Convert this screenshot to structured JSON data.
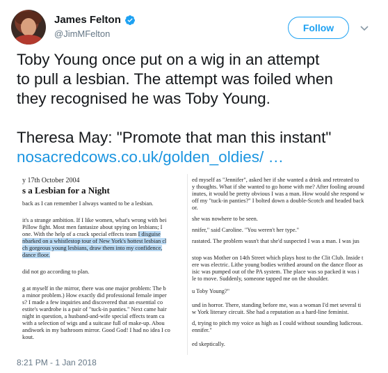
{
  "author": {
    "name": "James Felton",
    "handle": "@JimMFelton",
    "avatar_icon": "profile-photo",
    "verified_icon": "verified-badge-icon"
  },
  "actions": {
    "follow_label": "Follow",
    "more_icon": "chevron-down-icon"
  },
  "tweet": {
    "lines": [
      "Toby Young once put on a wig in an attempt",
      "to pull a lesbian. The attempt was foiled when",
      "they recognised he was Toby Young.",
      "Theresa May: \"Promote that man this instant\""
    ],
    "link": "nosacredcows.co.uk/golden_oldies/ …",
    "link_color": "#1b95e0"
  },
  "article": {
    "date": "y 17th October 2004",
    "headline": "s a Lesbian for a Night",
    "left_lines": [
      "back as I can remember I always wanted to be a lesbian.",
      "it's a strange ambition. If I like women, what's wrong with bei",
      "Pillow fight. Most men fantasize about spying on lesbians; I",
      "one. With the help of a crack special effects team I disguise",
      "nbarked on a whistlestop tour of New York's hottest lesbian cl",
      "ch gorgeous young lesbians, draw them into my confidence,",
      "dance floor.",
      "did not go according to plan.",
      "g at myself in the mirror, there was one major problem: The b",
      "a minor problem.) How exactly did professional female imper",
      "s? I made a few inquiries and discovered that an essential co",
      "estite's wardrobe is a pair of \"tuck-in panties.\" Next came hair",
      "night in question, a husband-and-wife special effects team ca",
      "with a selection of wigs and a suitcase full of make-up. Abou",
      "andiwork in my bathroom mirror. Good God! I had no idea I co",
      "kout."
    ],
    "right_lines": [
      "ed myself as \"Jennifer\", asked her if she wanted a drink and retreated to",
      "y thoughts. What if she wanted to go home with me? After fooling around",
      "inutes, it would be pretty obvious I was a man. How would she respond w",
      "off my \"tuck-in panties?\" I bolted down a double-Scotch and headed back",
      "or.",
      "she was nowhere to be seen.",
      "nnifer,\" said Caroline. \"You weren't her type.\"",
      "rastated. The problem wasn't that she'd suspected I was a man. I was jus",
      "stop was Mother on 14th Street which plays host to the Clit Club. Inside t",
      "ere was electric. Lithe young bodies writhed around on the dance floor as",
      "isic was pumped out of the PA system. The place was so packed it was i",
      "le to move. Suddenly, someone tapped me on the shoulder.",
      "u Toby Young?\"",
      "und in horror. There, standing before me, was a woman I'd met several ti",
      "w York literary circuit. She had a reputation as a hard-line feminist.",
      "d, trying to pitch my voice as high as I could without sounding ludicrous.",
      "ennifer.\"",
      "ed skeptically."
    ]
  },
  "timestamp": "8:21 PM - 1 Jan 2018"
}
